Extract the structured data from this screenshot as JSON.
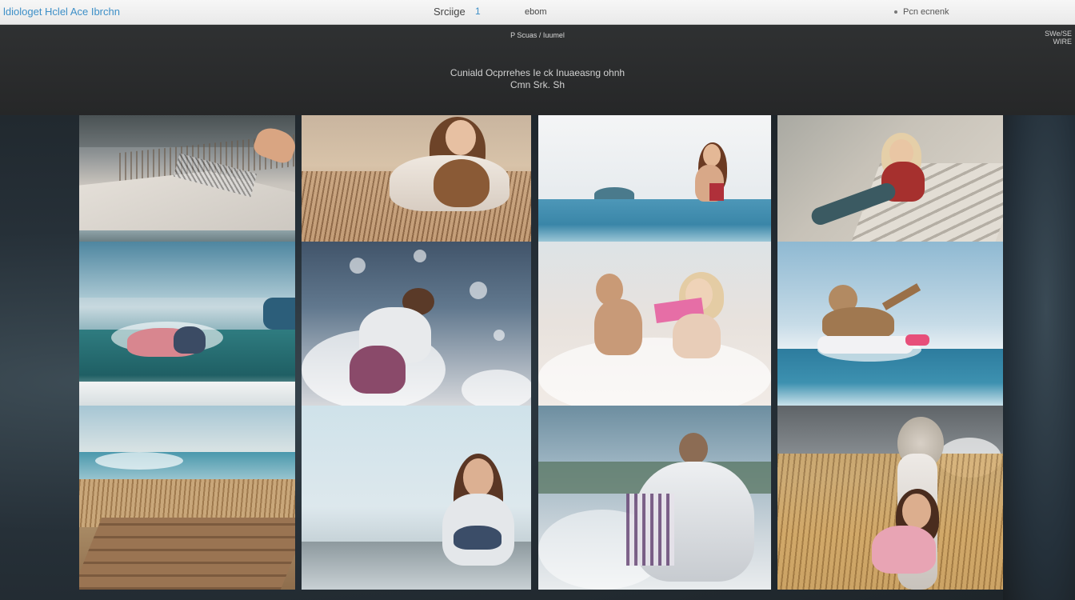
{
  "topbar": {
    "brand": "ldiologet Hclel Ace Ibrchn",
    "search_label": "Srciige",
    "search_count": "1",
    "nav_link": "ebom",
    "user_label": "Pcn ecnenk"
  },
  "header": {
    "small_caption": "P Scuas / Iuumel",
    "corner_line1": "SWe/SE",
    "corner_line2": "WIRE",
    "title": "Cuniald Ocprrehes  Ie  ck  Inuaeasng ohnh",
    "subtitle": "Cmn Srk. Sh"
  },
  "gallery": {
    "tiles": [
      {
        "name": "photo-tile-beach-sand",
        "icon": "photo-icon"
      },
      {
        "name": "photo-tile-woman-grass",
        "icon": "photo-icon"
      },
      {
        "name": "photo-tile-woman-ocean",
        "icon": "photo-icon"
      },
      {
        "name": "photo-tile-woman-lying",
        "icon": "photo-icon"
      },
      {
        "name": "photo-tile-wave",
        "icon": "photo-icon"
      },
      {
        "name": "photo-tile-splash",
        "icon": "photo-icon"
      },
      {
        "name": "photo-tile-two-girls",
        "icon": "photo-icon"
      },
      {
        "name": "photo-tile-child-surf",
        "icon": "photo-icon"
      },
      {
        "name": "photo-tile-boardwalk",
        "icon": "photo-icon"
      },
      {
        "name": "photo-tile-woman-portrait",
        "icon": "photo-icon"
      },
      {
        "name": "photo-tile-boy-back",
        "icon": "photo-icon"
      },
      {
        "name": "photo-tile-girl-wheat",
        "icon": "photo-icon"
      }
    ]
  },
  "colors": {
    "brand": "#3d8fc7",
    "topbar": "#f2f2f2",
    "header": "#2b2d2e",
    "background": "#1c2226"
  }
}
